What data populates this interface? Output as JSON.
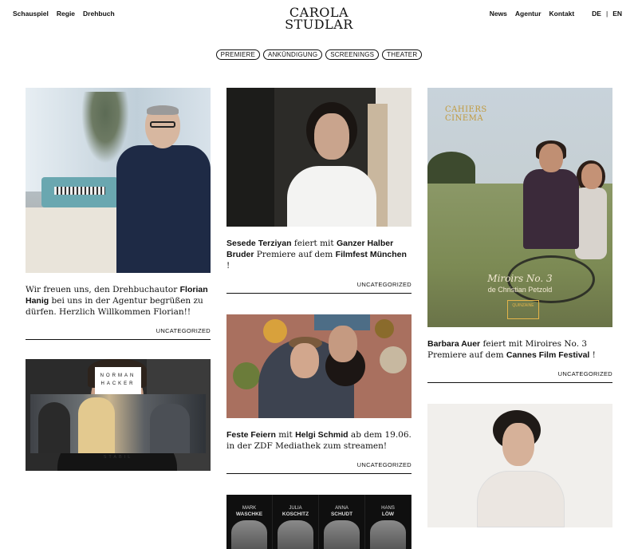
{
  "nav": {
    "left": [
      "Schauspiel",
      "Regie",
      "Drehbuch"
    ],
    "right": [
      "News",
      "Agentur",
      "Kontakt"
    ],
    "lang": [
      "DE",
      "|",
      "EN"
    ]
  },
  "logo": {
    "line1": "CAROLA",
    "line2": "STUDLAR"
  },
  "filters": [
    "PREMIERE",
    "ANKÜNDIGUNG",
    "SCREENINGS",
    "THEATER"
  ],
  "posts": {
    "florian": {
      "text1": "Wir freuen uns, den Drehbuchautor ",
      "bold1": "Florian Hanig",
      "text2": " bei uns in der Agentur begrüßen zu dürfen. Herzlich Willkommen Florian!!",
      "category": "UNCATEGORIZED"
    },
    "sesede": {
      "bold1": "Sesede Terziyan",
      "text1": " feiert mit ",
      "bold2": "Ganzer Halber Bruder",
      "text2": " Premiere auf dem ",
      "bold3": "Filmfest München",
      "text3": " !",
      "category": "UNCATEGORIZED"
    },
    "feste": {
      "bold1": "Feste Feiern",
      "text1": " mit ",
      "bold2": "Helgi Schmid",
      "text2": " ab dem 19.06. in der ZDF Mediathek zum streamen!",
      "category": "UNCATEGORIZED"
    },
    "posters": [
      {
        "first": "MARK",
        "last": "WASCHKE"
      },
      {
        "first": "JULIA",
        "last": "KOSCHITZ"
      },
      {
        "first": "ANNA",
        "last": "SCHUDT"
      },
      {
        "first": "HANS",
        "last": "LÖW"
      }
    ],
    "barbara": {
      "poster_line1": "CAHIERS",
      "poster_line2": "CINEMA",
      "movie_title": "Miroirs No. 3",
      "movie_sub": "de Christian Petzold",
      "festival_badge": "QUINZAINE",
      "bold1": "Barbara Auer",
      "text1": " feiert mit Miroires No. 3 Premiere auf dem ",
      "bold2": "Cannes Film Festival",
      "text2": " !",
      "category": "UNCATEGORIZED"
    },
    "norman": {
      "tag_line1": "NORMAN",
      "tag_line2": "HACKER",
      "stabil_label": "STABIL"
    }
  }
}
